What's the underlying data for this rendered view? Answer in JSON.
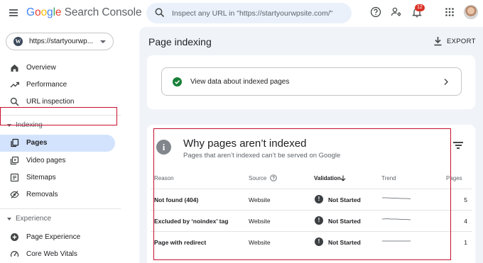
{
  "app": {
    "brand_letters": [
      "G",
      "o",
      "o",
      "g",
      "l",
      "e"
    ],
    "brand_rest": " Search Console"
  },
  "search": {
    "placeholder": "Inspect any URL in \"https://startyourwpsite.com/\""
  },
  "topbar": {
    "notification_count": "12",
    "icons": [
      "help-icon",
      "manage-accounts-icon",
      "notifications-icon",
      "apps-grid-icon",
      "avatar"
    ]
  },
  "sidebar": {
    "property": "https://startyourwp...",
    "items_top": [
      {
        "label": "Overview",
        "icon": "home-icon"
      },
      {
        "label": "Performance",
        "icon": "trending-up-icon"
      },
      {
        "label": "URL inspection",
        "icon": "search-icon"
      }
    ],
    "section_indexing": "Indexing",
    "items_indexing": [
      {
        "label": "Pages",
        "icon": "pages-icon",
        "active": true
      },
      {
        "label": "Video pages",
        "icon": "video-icon"
      },
      {
        "label": "Sitemaps",
        "icon": "sitemap-icon"
      },
      {
        "label": "Removals",
        "icon": "removals-icon"
      }
    ],
    "section_experience": "Experience",
    "items_experience": [
      {
        "label": "Page Experience",
        "icon": "plus-circle-icon"
      },
      {
        "label": "Core Web Vitals",
        "icon": "gauge-icon"
      }
    ]
  },
  "main": {
    "title": "Page indexing",
    "export_label": "EXPORT",
    "indexed_link": "View data about indexed pages",
    "why": {
      "title": "Why pages aren’t indexed",
      "subtitle": "Pages that aren’t indexed can’t be served on Google"
    },
    "table": {
      "headers": {
        "reason": "Reason",
        "source": "Source",
        "validation": "Validation",
        "trend": "Trend",
        "pages": "Pages"
      },
      "rows": [
        {
          "reason": "Not found (404)",
          "source": "Website",
          "validation": "Not Started",
          "pages": "5",
          "trend": [
            6,
            6,
            6.5,
            6.5,
            7,
            7,
            7.5
          ]
        },
        {
          "reason": "Excluded by ‘noindex’ tag",
          "source": "Website",
          "validation": "Not Started",
          "pages": "4",
          "trend": [
            6,
            5.5,
            6,
            6,
            6.5,
            6.5,
            7
          ]
        },
        {
          "reason": "Page with redirect",
          "source": "Website",
          "validation": "Not Started",
          "pages": "1",
          "trend": [
            7,
            7,
            7,
            7,
            7,
            7,
            7
          ]
        }
      ]
    }
  },
  "colors": {
    "accent": "#1a73e8",
    "active_nav": "#d3e3fd",
    "main_bg": "#f0f4f9",
    "success": "#188038",
    "highlight_outline": "#c8102e",
    "badge": "#d93025"
  }
}
